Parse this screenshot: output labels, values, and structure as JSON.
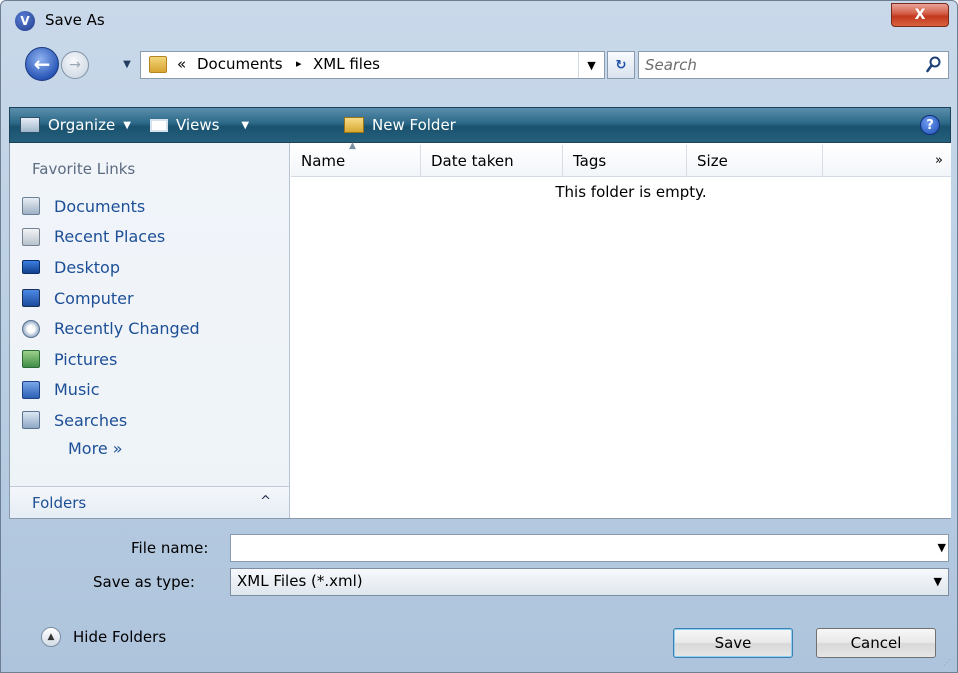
{
  "window": {
    "title": "Save As",
    "app_icon_glyph": "V",
    "close_glyph": "X"
  },
  "nav": {
    "back_glyph": "←",
    "forward_glyph": "→",
    "recent_glyph": "▼"
  },
  "address": {
    "overflow": "«",
    "crumbs": [
      "Documents",
      "XML files"
    ],
    "separator": "▸",
    "dropdown_glyph": "▼"
  },
  "refresh_glyph": "↻",
  "search": {
    "placeholder": "Search"
  },
  "toolbar": {
    "organize_label": "Organize",
    "views_label": "Views",
    "new_folder_label": "New Folder",
    "caret": "▼",
    "help_glyph": "?"
  },
  "sidebar": {
    "favorites_header": "Favorite Links",
    "items": [
      {
        "label": "Documents",
        "icon": "documents-icon"
      },
      {
        "label": "Recent Places",
        "icon": "recent-places-icon"
      },
      {
        "label": "Desktop",
        "icon": "desktop-icon"
      },
      {
        "label": "Computer",
        "icon": "computer-icon"
      },
      {
        "label": "Recently Changed",
        "icon": "recently-changed-icon"
      },
      {
        "label": "Pictures",
        "icon": "pictures-icon"
      },
      {
        "label": "Music",
        "icon": "music-icon"
      },
      {
        "label": "Searches",
        "icon": "searches-icon"
      }
    ],
    "more_label": "More »",
    "folders_label": "Folders",
    "folders_chevron": "^"
  },
  "file_list": {
    "columns": [
      "Name",
      "Date taken",
      "Tags",
      "Size"
    ],
    "more_columns_glyph": "»",
    "sort_glyph": "▲",
    "empty_message": "This folder is empty."
  },
  "form": {
    "filename_label": "File name:",
    "filename_value": "",
    "save_type_label": "Save as type:",
    "save_type_value": "XML Files (*.xml)",
    "dropdown_glyph": "▼"
  },
  "footer": {
    "hide_folders_label": "Hide Folders",
    "hide_glyph": "▲",
    "save_label": "Save",
    "cancel_label": "Cancel"
  },
  "colors": {
    "toolbar_accent": "#245f7c",
    "link_blue": "#1d4f96",
    "close_red": "#c2381e"
  }
}
